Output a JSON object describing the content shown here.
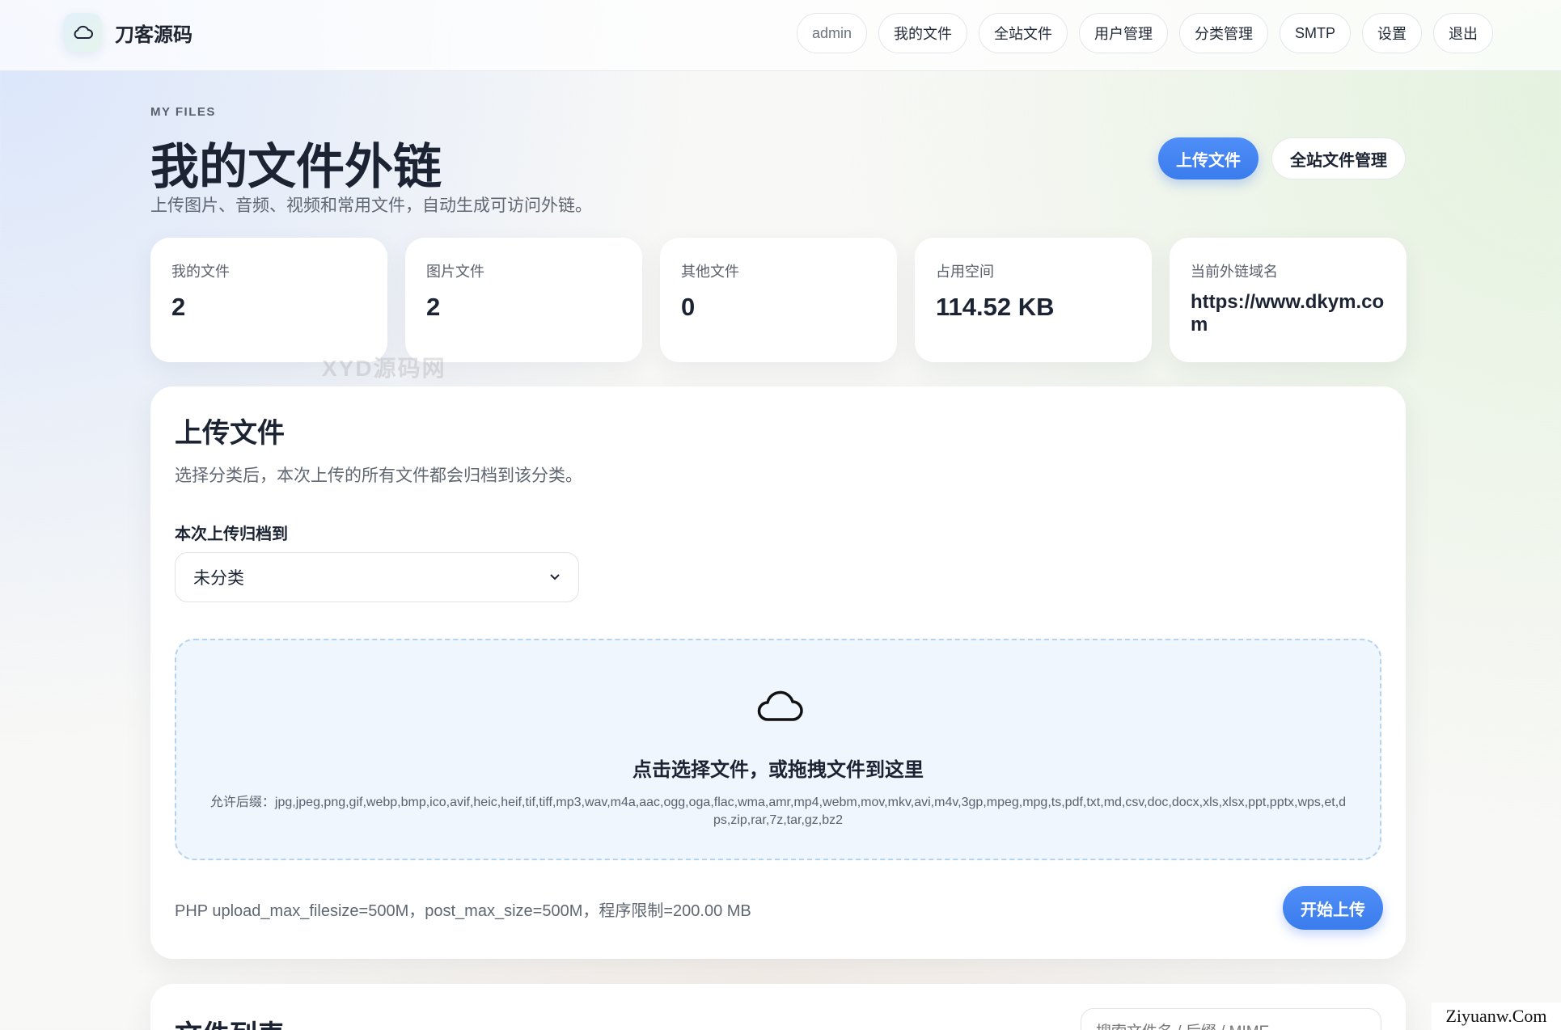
{
  "brand": {
    "name": "刀客源码"
  },
  "nav": {
    "user": "admin",
    "items": [
      "我的文件",
      "全站文件",
      "用户管理",
      "分类管理",
      "SMTP",
      "设置",
      "退出"
    ]
  },
  "header": {
    "eyebrow": "MY FILES",
    "title": "我的文件外链",
    "subtitle": "上传图片、音频、视频和常用文件，自动生成可访问外链。",
    "upload_btn": "上传文件",
    "manage_btn": "全站文件管理"
  },
  "stats": [
    {
      "label": "我的文件",
      "value": "2"
    },
    {
      "label": "图片文件",
      "value": "2"
    },
    {
      "label": "其他文件",
      "value": "0"
    },
    {
      "label": "占用空间",
      "value": "114.52 KB"
    },
    {
      "label": "当前外链域名",
      "value": "https://www.dkym.com"
    }
  ],
  "watermark": "XYD源码网",
  "upload": {
    "title": "上传文件",
    "desc": "选择分类后，本次上传的所有文件都会归档到该分类。",
    "field_label": "本次上传归档到",
    "selected_category": "未分类",
    "dropzone_title": "点击选择文件，或拖拽文件到这里",
    "allowed": "允许后缀：jpg,jpeg,png,gif,webp,bmp,ico,avif,heic,heif,tif,tiff,mp3,wav,m4a,aac,ogg,oga,flac,wma,amr,mp4,webm,mov,mkv,avi,m4v,3gp,mpeg,mpg,ts,pdf,txt,md,csv,doc,docx,xls,xlsx,ppt,pptx,wps,et,dps,zip,rar,7z,tar,gz,bz2",
    "limits": "PHP upload_max_filesize=500M，post_max_size=500M，程序限制=200.00 MB",
    "start_btn": "开始上传"
  },
  "files": {
    "title": "文件列表",
    "search_placeholder": "搜索文件名 / 后缀 / MIME"
  },
  "site_mark": "Ziyuanw.Com"
}
